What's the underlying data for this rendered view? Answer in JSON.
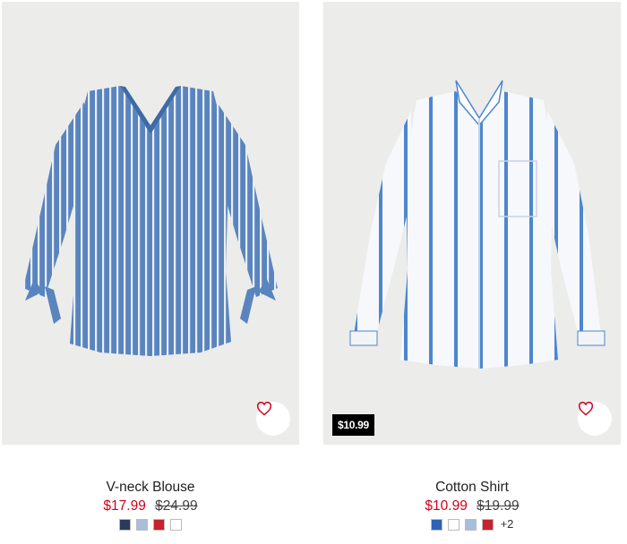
{
  "products": [
    {
      "name": "V-neck Blouse",
      "price": "$17.99",
      "original_price": "$24.99",
      "badge": "",
      "swatches": [
        "#2b3a58",
        "#a7bedc",
        "#c8222c",
        "#ffffff"
      ],
      "more_colors": ""
    },
    {
      "name": "Cotton Shirt",
      "price": "$10.99",
      "original_price": "$19.99",
      "badge": "$10.99",
      "swatches": [
        "#2e63b3",
        "#ffffff",
        "#a7bedc",
        "#c8222c"
      ],
      "more_colors": "+2"
    }
  ],
  "colors": {
    "sale_red": "#d0021b",
    "image_bg": "#ececea",
    "heart": "#d0021b"
  }
}
